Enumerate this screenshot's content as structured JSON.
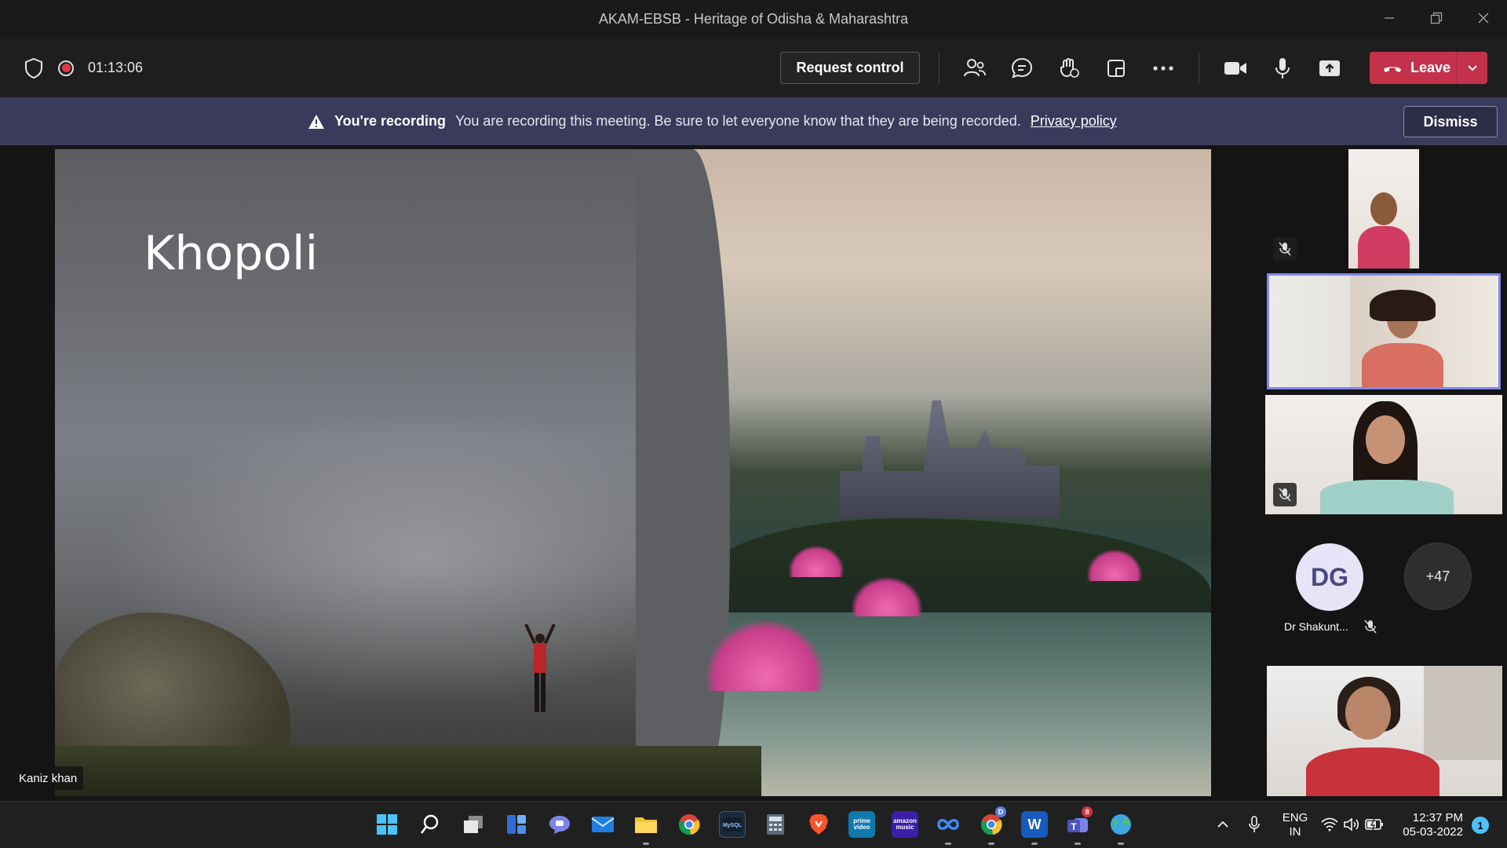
{
  "window": {
    "title": "AKAM-EBSB - Heritage of Odisha & Maharashtra"
  },
  "toolbar": {
    "timer": "01:13:06",
    "request_control_label": "Request control",
    "leave_label": "Leave",
    "icons": [
      "shield-icon",
      "record-icon",
      "people-icon",
      "chat-icon",
      "raise-hand-icon",
      "rooms-icon",
      "more-icon",
      "camera-icon",
      "mic-icon",
      "share-icon"
    ]
  },
  "banner": {
    "heading": "You're recording",
    "message": "You are recording this meeting. Be sure to let everyone know that they are being recorded.",
    "link": "Privacy policy",
    "dismiss_label": "Dismiss"
  },
  "stage": {
    "slide_title": "Khopoli",
    "presenter_name": "Kaniz khan"
  },
  "participants": {
    "avatar_initials": "DG",
    "avatar_name": "Dr Shakunt...",
    "overflow_count": "+47"
  },
  "taskbar": {
    "apps": [
      "start",
      "search",
      "task-view",
      "widgets",
      "chat",
      "mail",
      "file-explorer",
      "chrome",
      "mysql",
      "calculator",
      "brave",
      "prime-video",
      "amazon-music",
      "edge-app",
      "chrome-profile",
      "word",
      "teams",
      "browser"
    ],
    "prime_label": "prime video",
    "music_label": "amazon music",
    "word_label": "W",
    "teams_badge": "8",
    "chrome_badge": "D",
    "lang_top": "ENG",
    "lang_bottom": "IN",
    "time": "12:37 PM",
    "date": "05-03-2022",
    "notification_count": "1"
  },
  "colors": {
    "leave": "#c4314b",
    "banner": "#393a5c",
    "accent": "#7f85f5"
  }
}
